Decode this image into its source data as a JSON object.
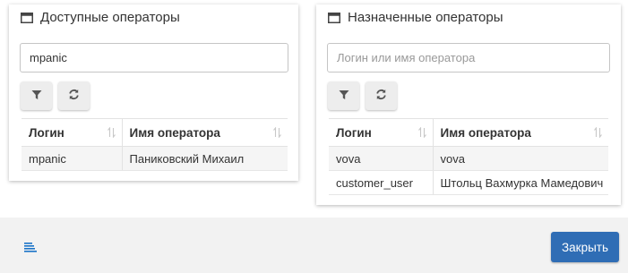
{
  "available": {
    "title": "Доступные операторы",
    "search_value": "mpanic",
    "search_placeholder": "Логин или имя оператора",
    "columns": [
      "Логин",
      "Имя оператора"
    ],
    "rows": [
      {
        "login": "mpanic",
        "name": "Паниковский Михаил"
      }
    ]
  },
  "assigned": {
    "title": "Назначенные операторы",
    "search_value": "",
    "search_placeholder": "Логин или имя оператора",
    "columns": [
      "Логин",
      "Имя оператора"
    ],
    "rows": [
      {
        "login": "vova",
        "name": "vova"
      },
      {
        "login": "customer_user",
        "name": "Штольц Вахмурка Мамедович"
      }
    ]
  },
  "footer": {
    "close_label": "Закрыть"
  },
  "colors": {
    "accent": "#2f6db5",
    "footer_bg": "#f2f2f2",
    "menu_icon": "#1a73c8"
  },
  "icons": {
    "panel_title": "window-icon",
    "filter": "filter-icon",
    "refresh": "refresh-icon",
    "sort": "sort-icon",
    "menu": "list-lines-icon"
  }
}
